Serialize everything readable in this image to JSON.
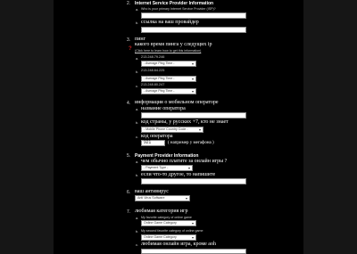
{
  "sections": {
    "s2": {
      "number": "2.",
      "heading": "Internet Service Provider Information",
      "a_letter": "a.",
      "a_text": "Who is your primary Internet Service Provider (ISP)?",
      "b_letter": "b.",
      "b_text": "ссылка на ваш провайдер"
    },
    "s3": {
      "number": "3.",
      "heading_line1": "пинг",
      "heading_line2": "какого время пинга у следущих ip",
      "help": "(Click here to learn how to get this information)",
      "mark": "?",
      "rows": [
        {
          "letter": "a.",
          "ip": "213.248.79.246",
          "select": "- Average Ping Time -"
        },
        {
          "letter": "b.",
          "ip": "213.248.64.225",
          "select": "- Average Ping Time -"
        },
        {
          "letter": "c.",
          "ip": "213.248.80.247",
          "select": "- Average Ping Time -"
        }
      ]
    },
    "s4": {
      "number": "4.",
      "heading": "информация о мобильном операторе",
      "a_letter": "a.",
      "a_text": "название оператора",
      "b_letter": "b.",
      "b_text": "код страны, у русских +7, кто не знает",
      "b_select": "- Mobile Phone Country Code -",
      "c_letter": "c.",
      "c_text": "код оператора",
      "c_value": "921",
      "c_hint": "( например у мегафона )"
    },
    "s5": {
      "number": "5.",
      "heading": "Payment Provider Information",
      "a_letter": "a.",
      "a_text": "чем обычно платите за онлайн игры ?",
      "a_select": "- Payment Type -",
      "b_letter": "b.",
      "b_text": "если что-то другое, то напишите"
    },
    "s6": {
      "number": "6.",
      "heading": "ваш антивирус",
      "select": "Anti Virus Software"
    },
    "s7": {
      "number": "7.",
      "heading": "любимая категория игр",
      "a_letter": "a.",
      "a_text": "My favorite category of online game",
      "a_select": "Online Game Category",
      "b_letter": "b.",
      "b_text": "My second favorite category of online game",
      "b_select": "Online Game Category",
      "c_letter": "c.",
      "c_text": "любимая онлайн игра, кроме aoh"
    }
  },
  "colors": {
    "background": "#000000",
    "side": "#161616",
    "mark": "#c62222"
  },
  "icons": {
    "select_arrow": "chevron-down-icon",
    "help_mark": "question-mark-icon"
  }
}
